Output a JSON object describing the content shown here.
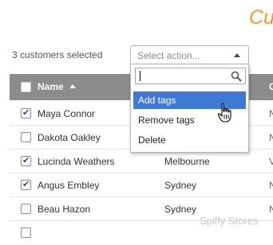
{
  "header": {
    "title": "Cu"
  },
  "toolbar": {
    "selected_count": "3 customers selected",
    "bulk_action_placeholder": "Select action..."
  },
  "table": {
    "columns": {
      "name": "Name",
      "partial": "C"
    },
    "rows": [
      {
        "checked": true,
        "name": "Maya Connor",
        "city": "",
        "extra": "N"
      },
      {
        "checked": false,
        "name": "Dakota Oakley",
        "city": "",
        "extra": "N"
      },
      {
        "checked": true,
        "name": "Lucinda Weathers",
        "city": "Melbourne",
        "extra": "V"
      },
      {
        "checked": true,
        "name": "Angus Embley",
        "city": "Sydney",
        "extra": "N"
      },
      {
        "checked": false,
        "name": "Beau Hazon",
        "city": "Sydney",
        "extra": "N"
      }
    ]
  },
  "dropdown": {
    "search_value": "",
    "options": [
      {
        "label": "Add tags",
        "highlighted": true
      },
      {
        "label": "Remove tags",
        "highlighted": false
      },
      {
        "label": "Delete",
        "highlighted": false
      }
    ]
  },
  "watermark": "Spiffy Stores",
  "colors": {
    "title": "#f29a2e",
    "highlight": "#3d7ad6",
    "table_header": "#8c8c8c"
  },
  "icons": {
    "search": "magnifier",
    "cursor": "hand-pointer"
  }
}
